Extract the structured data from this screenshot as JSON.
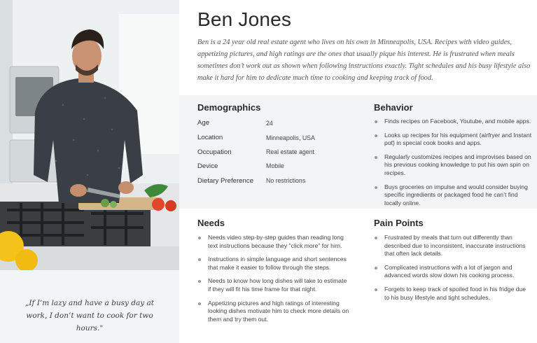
{
  "persona": {
    "name": "Ben Jones",
    "bio": "Ben is a 24 year old real estate agent who lives on his own in Minneapolis, USA. Recipes with video guides, appetizing pictures, and high ratings are the ones that usually pique his interest. He is frustrated when meals sometimes don’t work out as shown when following instructions exactly. Tight schedules and his busy lifestyle also make it hard for him to dedicate much time to cooking and keeping track of  food.",
    "quote": "„If I’m lazy and have a busy day at work, I don’t want to cook for two hours.\""
  },
  "demographics": {
    "title": "Demographics",
    "rows": [
      {
        "label": "Age",
        "value": "24"
      },
      {
        "label": "Location",
        "value": "Minneapolis, USA"
      },
      {
        "label": "Occupation",
        "value": "Real estate agent"
      },
      {
        "label": "Device",
        "value": "Mobile"
      },
      {
        "label": "Dietary Preference",
        "value": "No restrictions"
      }
    ]
  },
  "behavior": {
    "title": "Behavior",
    "items": [
      "Finds recipes on Facebook, Youtube, and mobile apps.",
      "Looks up recipes for his equipment (airfryer and Instant pot) in special cook books and apps.",
      "Regularly customizes recipes and improvises based on his previous cooking knowledge to put his own spin on recipes.",
      "Buys groceries on impulse and would consider buying specific ingredients or packaged food he can’t find locally online."
    ]
  },
  "needs": {
    "title": "Needs",
    "items": [
      "Needs video step-by-step guides than reading long text instructions because they \"click more\" for him.",
      "Instructions in simple language and short sentences that make it easier to follow through the steps.",
      "Needs to know how long dishes will take to estimate if they will fit his time frame for that night.",
      "Appetizing pictures and high ratings of interesting looking dishes motivate him to check more details on them and try them out."
    ]
  },
  "pain_points": {
    "title": "Pain Points",
    "items": [
      "Frustrated by meals that turn out differently than described due to inconsistent, inaccurate instructions that often lack details.",
      "Complicated instructions with a lot of jargon and advanced words slow down his cooking process.",
      "Forgets to keep track of spoiled food in his fridge due to his busy lifestyle and tight schedules."
    ]
  }
}
